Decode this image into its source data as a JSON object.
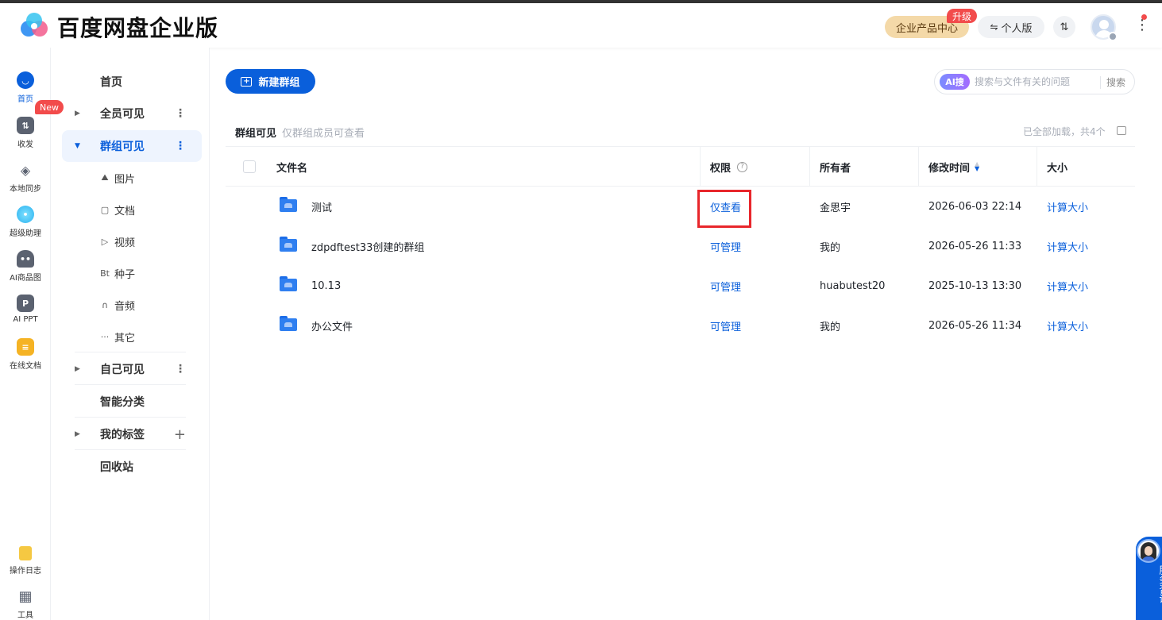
{
  "header": {
    "brand": "百度网盘企业版",
    "enterprise_center": "企业产品中心",
    "upgrade_badge": "升级",
    "personal_edition": "个人版",
    "sync_icon_label": "⇅"
  },
  "rail": {
    "items": [
      {
        "label": "首页",
        "icon": "home-icon"
      },
      {
        "label": "收发",
        "icon": "transfer-icon"
      },
      {
        "label": "本地同步",
        "icon": "sync-icon"
      },
      {
        "label": "超级助理",
        "icon": "assistant-icon"
      },
      {
        "label": "AI商品图",
        "icon": "ai-product-icon"
      },
      {
        "label": "AI PPT",
        "icon": "ppt-icon"
      },
      {
        "label": "在线文档",
        "icon": "doc-icon"
      },
      {
        "label": "操作日志",
        "icon": "log-icon"
      },
      {
        "label": "工具",
        "icon": "tools-icon"
      }
    ],
    "new_badge": "New"
  },
  "sidebar": {
    "home": "首页",
    "all_visible": "全员可见",
    "group_visible": "群组可见",
    "sub": [
      {
        "icon": "image-icon",
        "glyph": "⛰",
        "label": "图片"
      },
      {
        "icon": "file-icon",
        "glyph": "▢",
        "label": "文档"
      },
      {
        "icon": "video-icon",
        "glyph": "▷",
        "label": "视频"
      },
      {
        "icon": "torrent-icon",
        "glyph": "Bt",
        "label": "种子"
      },
      {
        "icon": "audio-icon",
        "glyph": "∩",
        "label": "音频"
      },
      {
        "icon": "other-icon",
        "glyph": "···",
        "label": "其它"
      }
    ],
    "self_visible": "自己可见",
    "smart_category": "智能分类",
    "my_tags": "我的标签",
    "recycle_bin": "回收站"
  },
  "main": {
    "new_group_button": "新建群组",
    "search": {
      "ai_tag": "AI搜",
      "placeholder": "搜索与文件有关的问题",
      "button": "搜索"
    },
    "filter_title": "群组可见",
    "filter_desc": "仅群组成员可查看",
    "load_status": "已全部加载，共4个",
    "columns": {
      "name": "文件名",
      "permission": "权限",
      "owner": "所有者",
      "modified": "修改时间",
      "size": "大小"
    },
    "rows": [
      {
        "name": "测试",
        "permission": "仅查看",
        "owner": "金思宇",
        "modified": "2026-06-03 22:14",
        "size": "计算大小"
      },
      {
        "name": "zdpdftest33创建的群组",
        "permission": "可管理",
        "owner": "我的",
        "modified": "2026-05-26 11:33",
        "size": "计算大小"
      },
      {
        "name": "10.13",
        "permission": "可管理",
        "owner": "huabutest20",
        "modified": "2025-10-13 13:30",
        "size": "计算大小"
      },
      {
        "name": "办公文件",
        "permission": "可管理",
        "owner": "我的",
        "modified": "2026-05-26 11:34",
        "size": "计算大小"
      }
    ]
  },
  "service": {
    "label": "服务咨询"
  },
  "colors": {
    "accent": "#0a5fdb",
    "highlight": "#e8262b",
    "badge": "#f24b4b"
  }
}
